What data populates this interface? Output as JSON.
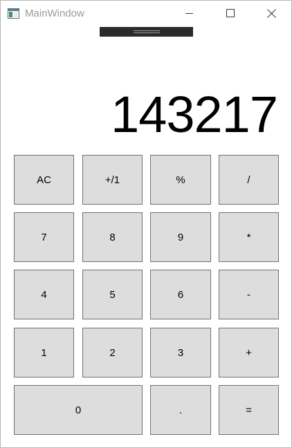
{
  "window": {
    "title": "MainWindow"
  },
  "display": {
    "value": "143217"
  },
  "buttons": {
    "ac": "AC",
    "plus_minus": "+/1",
    "percent": "%",
    "divide": "/",
    "seven": "7",
    "eight": "8",
    "nine": "9",
    "multiply": "*",
    "four": "4",
    "five": "5",
    "six": "6",
    "subtract": "-",
    "one": "1",
    "two": "2",
    "three": "3",
    "add": "+",
    "zero": "0",
    "decimal": ".",
    "equals": "="
  },
  "icons": {
    "app": "window-app-icon",
    "minimize": "minimize-icon",
    "maximize": "maximize-icon",
    "close": "close-icon"
  },
  "colors": {
    "button_bg": "#dddddd",
    "button_border": "#707070",
    "title_text": "#9a9a9a"
  }
}
